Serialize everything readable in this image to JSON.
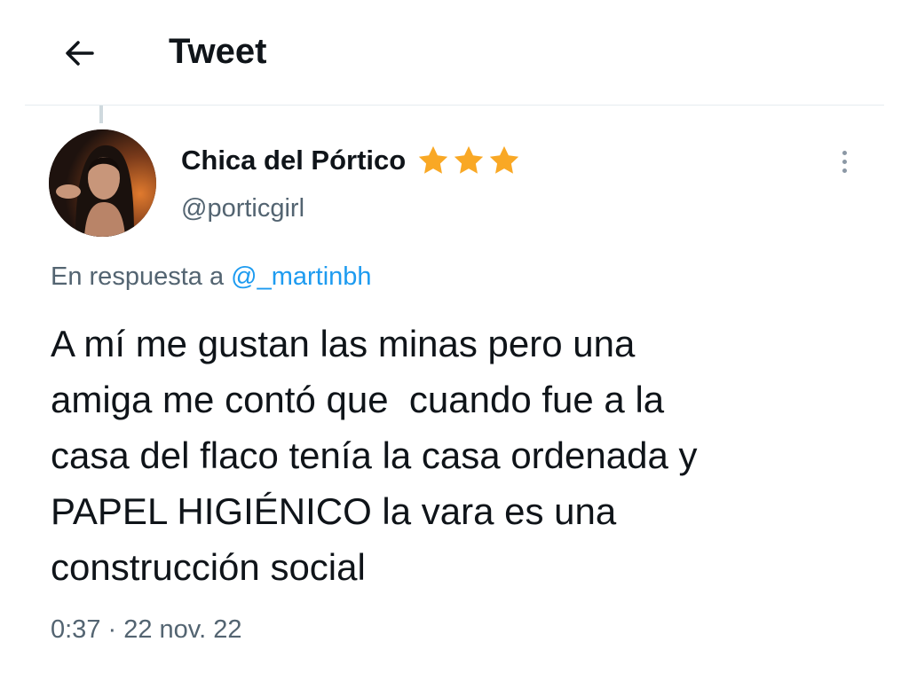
{
  "header": {
    "title": "Tweet",
    "back_icon": "arrow-left-icon"
  },
  "tweet": {
    "author": {
      "display_name": "Chica del Pórtico",
      "handle": "@porticgirl",
      "badge_icon": "star-icon",
      "badge_count": 3,
      "badge_color": "#f9a825"
    },
    "reply_prefix": "En respuesta a ",
    "reply_to": "@_martinbh",
    "text_lines": [
      "A mí me gustan las minas pero una",
      "amiga me contó que  cuando fue a la",
      "casa del flaco tenía la casa ordenada y",
      "PAPEL HIGIÉNICO la vara es una",
      "construcción social"
    ],
    "timestamp": "0:37 · 22 nov. 22",
    "more_icon": "more-vertical-icon"
  },
  "colors": {
    "text": "#0f1419",
    "secondary": "#536471",
    "link": "#1d9bf0",
    "divider": "#e6ecf0"
  }
}
